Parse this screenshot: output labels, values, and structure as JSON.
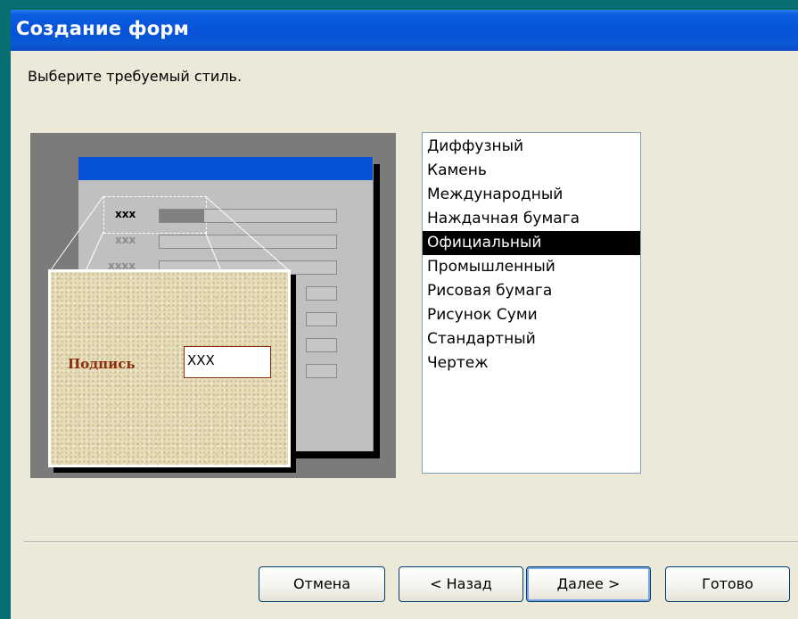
{
  "window": {
    "title": "Создание форм"
  },
  "prompt": "Выберите требуемый стиль.",
  "preview": {
    "row_labels": [
      "xxx",
      "xxx",
      "xxxx"
    ],
    "sample_label": "Подпись",
    "sample_value": "XXX"
  },
  "styles": {
    "items": [
      "Диффузный",
      "Камень",
      "Международный",
      "Наждачная бумага",
      "Официальный",
      "Промышленный",
      "Рисовая бумага",
      "Рисунок Суми",
      "Стандартный",
      "Чертеж"
    ],
    "selected": "Официальный"
  },
  "buttons": {
    "cancel": "Отмена",
    "back": "< Назад",
    "next": "Далее >",
    "finish": "Готово"
  },
  "colors": {
    "title_bar": "#0752d6",
    "selection": "#000000",
    "dialog_bg": "#ece9d8"
  }
}
